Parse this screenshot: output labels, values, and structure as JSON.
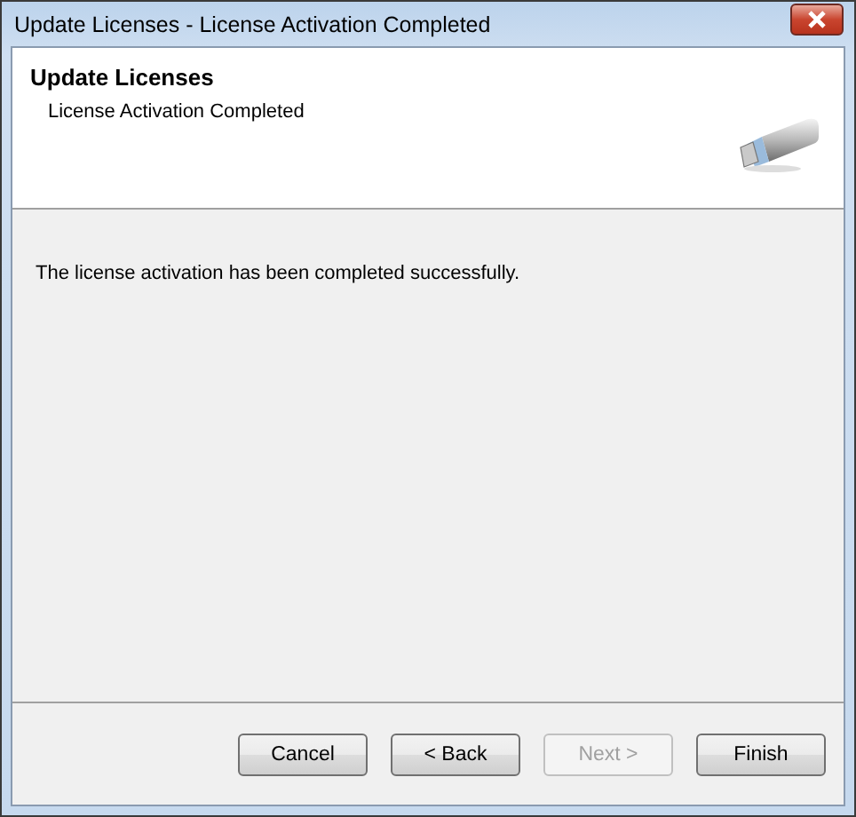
{
  "window": {
    "title": "Update Licenses - License Activation Completed"
  },
  "header": {
    "title": "Update Licenses",
    "subtitle": "License Activation Completed"
  },
  "message": "The license activation has been completed successfully.",
  "buttons": [
    {
      "label": "Cancel",
      "disabled": false
    },
    {
      "label": "< Back",
      "disabled": false
    },
    {
      "label": "Next >",
      "disabled": true
    },
    {
      "label": "Finish",
      "disabled": false
    }
  ]
}
